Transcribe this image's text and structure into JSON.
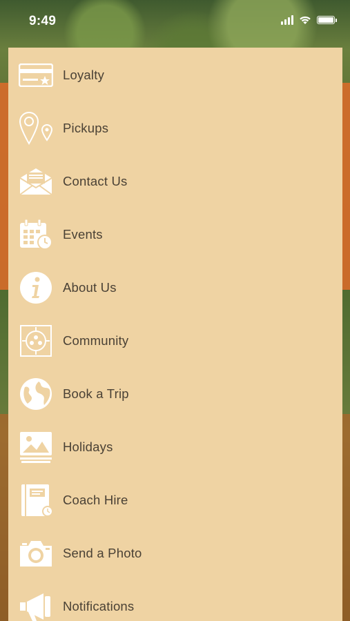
{
  "status_bar": {
    "time": "9:49"
  },
  "menu": {
    "items": [
      {
        "label": "Loyalty",
        "icon": "loyalty-card-icon"
      },
      {
        "label": "Pickups",
        "icon": "map-pin-icon"
      },
      {
        "label": "Contact Us",
        "icon": "envelope-icon"
      },
      {
        "label": "Events",
        "icon": "calendar-icon"
      },
      {
        "label": "About Us",
        "icon": "info-icon"
      },
      {
        "label": "Community",
        "icon": "community-icon"
      },
      {
        "label": "Book a Trip",
        "icon": "globe-icon"
      },
      {
        "label": "Holidays",
        "icon": "picture-icon"
      },
      {
        "label": "Coach Hire",
        "icon": "notebook-icon"
      },
      {
        "label": "Send a Photo",
        "icon": "camera-icon"
      },
      {
        "label": "Notifications",
        "icon": "megaphone-icon"
      }
    ]
  },
  "colors": {
    "panel": "#efd3a3",
    "label": "#4a4135",
    "icon": "#ffffff"
  }
}
